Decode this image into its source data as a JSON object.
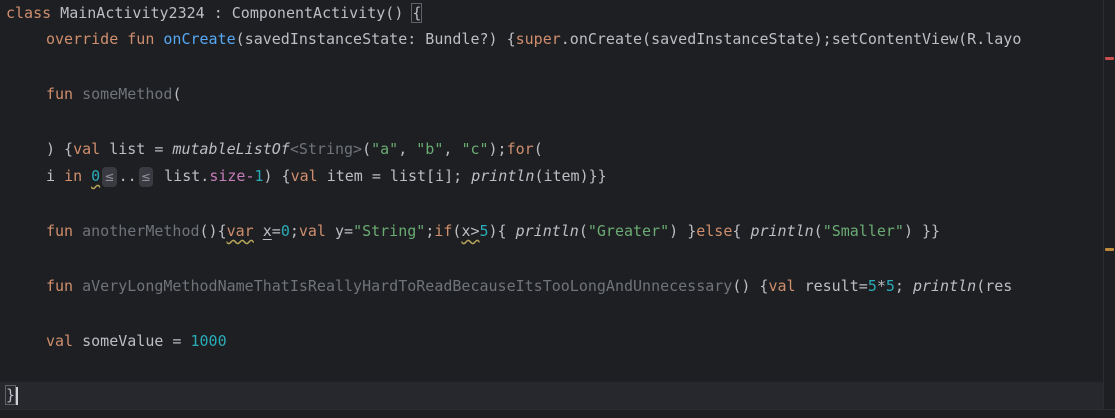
{
  "class_line": {
    "kw": "class",
    "name": " MainActivity2324 : ComponentActivity() ",
    "brace": "{"
  },
  "oncreate_line": {
    "kw1": "override",
    "kw2": "fun",
    "fn": "onCreate",
    "params": "(savedInstanceState: Bundle?) {",
    "super": "super",
    "call": ".onCreate(savedInstanceState);setContentView(R.layo"
  },
  "some_method_line": {
    "kw": "fun",
    "fn": "someMethod",
    "paren": "("
  },
  "list_line": {
    "p1": ") {",
    "kw": "val",
    "p2": " list = ",
    "fn": "mutableListOf",
    "gen": "<String>",
    "p3": "(",
    "s1": "\"a\"",
    "sep1": ", ",
    "s2": "\"b\"",
    "sep2": ", ",
    "s3": "\"c\"",
    "p4": ");",
    "for": "for",
    "p5": "("
  },
  "for_line": {
    "i": "i",
    "in": "in",
    "zero": "0",
    "hint1": "≤",
    "dots": "..",
    "hint2": "≤",
    "list": " list.",
    "size": "size",
    "minus": "-",
    "one": "1",
    "p1": ") {",
    "kw": "val",
    "p2": " item = list[i]; ",
    "fn": "println",
    "p3": "(item)}}"
  },
  "another_line": {
    "kw": "fun",
    "fn": "anotherMethod",
    "p1": "(){",
    "var": "var",
    "sp": " ",
    "x": "x",
    "p2": "=",
    "zero": "0",
    "p3": ";",
    "val": "val",
    "p4": " y=",
    "s1": "\"String\"",
    "p5": ";",
    "if": "if",
    "p6": "(",
    "cond": "x>",
    "five": "5",
    "p7": "){ ",
    "fn1": "println",
    "p8": "(",
    "s2": "\"Greater\"",
    "p9": ") }",
    "else": "else",
    "p10": "{ ",
    "fn2": "println",
    "p11": "(",
    "s3": "\"Smaller\"",
    "p12": ") }}"
  },
  "long_line": {
    "kw": "fun",
    "fn": "aVeryLongMethodNameThatIsReallyHardToReadBecauseItsTooLongAndUnnecessary",
    "p1": "() {",
    "val": "val",
    "p2": " result=",
    "n1": "5",
    "op": "*",
    "n2": "5",
    "p3": "; ",
    "fn2": "println",
    "p4": "(res"
  },
  "value_line": {
    "kw": "val",
    "name": " someValue = ",
    "num": "1000"
  },
  "close_line": {
    "brace": "}"
  }
}
